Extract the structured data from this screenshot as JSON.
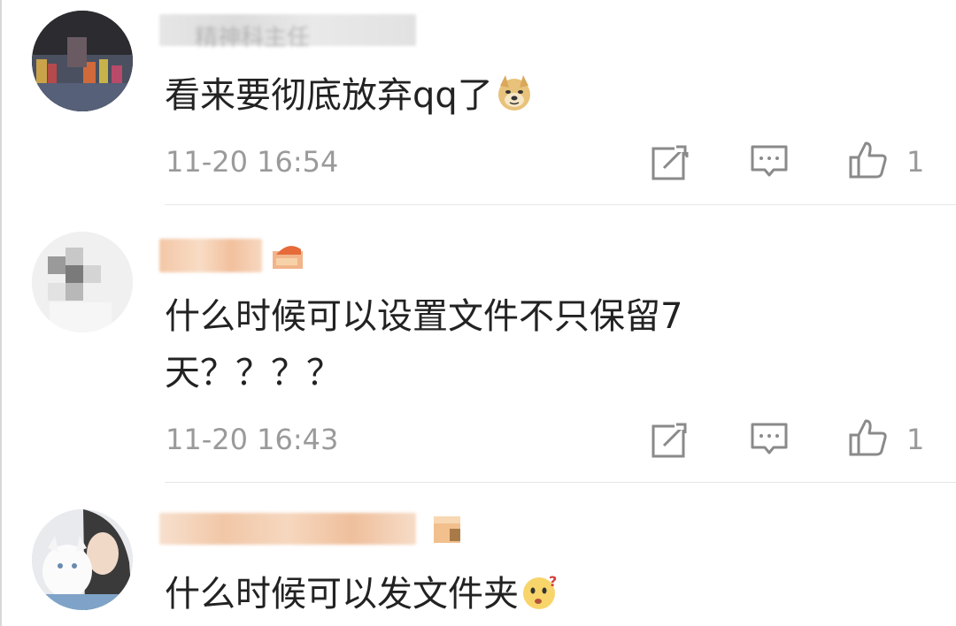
{
  "comments": [
    {
      "name": "精神科主任",
      "text": "看来要彻底放弃qq了",
      "emoji": "doge-emoji",
      "time": "11-20 16:54",
      "likes": "1"
    },
    {
      "name": "",
      "text_line1": "什么时候可以设置文件不只保留7",
      "text_line2": "天？？？？",
      "time": "11-20 16:43",
      "likes": "1"
    },
    {
      "name": "",
      "text": "什么时候可以发文件夹",
      "emoji": "thinking-emoji"
    }
  ],
  "icons": {
    "share": "share-icon",
    "reply": "comment-icon",
    "like": "thumbs-up-icon"
  },
  "colors": {
    "text": "#222222",
    "meta": "#9a9a9a",
    "icon": "#8a8a8a",
    "divider": "#e6e6e6"
  }
}
